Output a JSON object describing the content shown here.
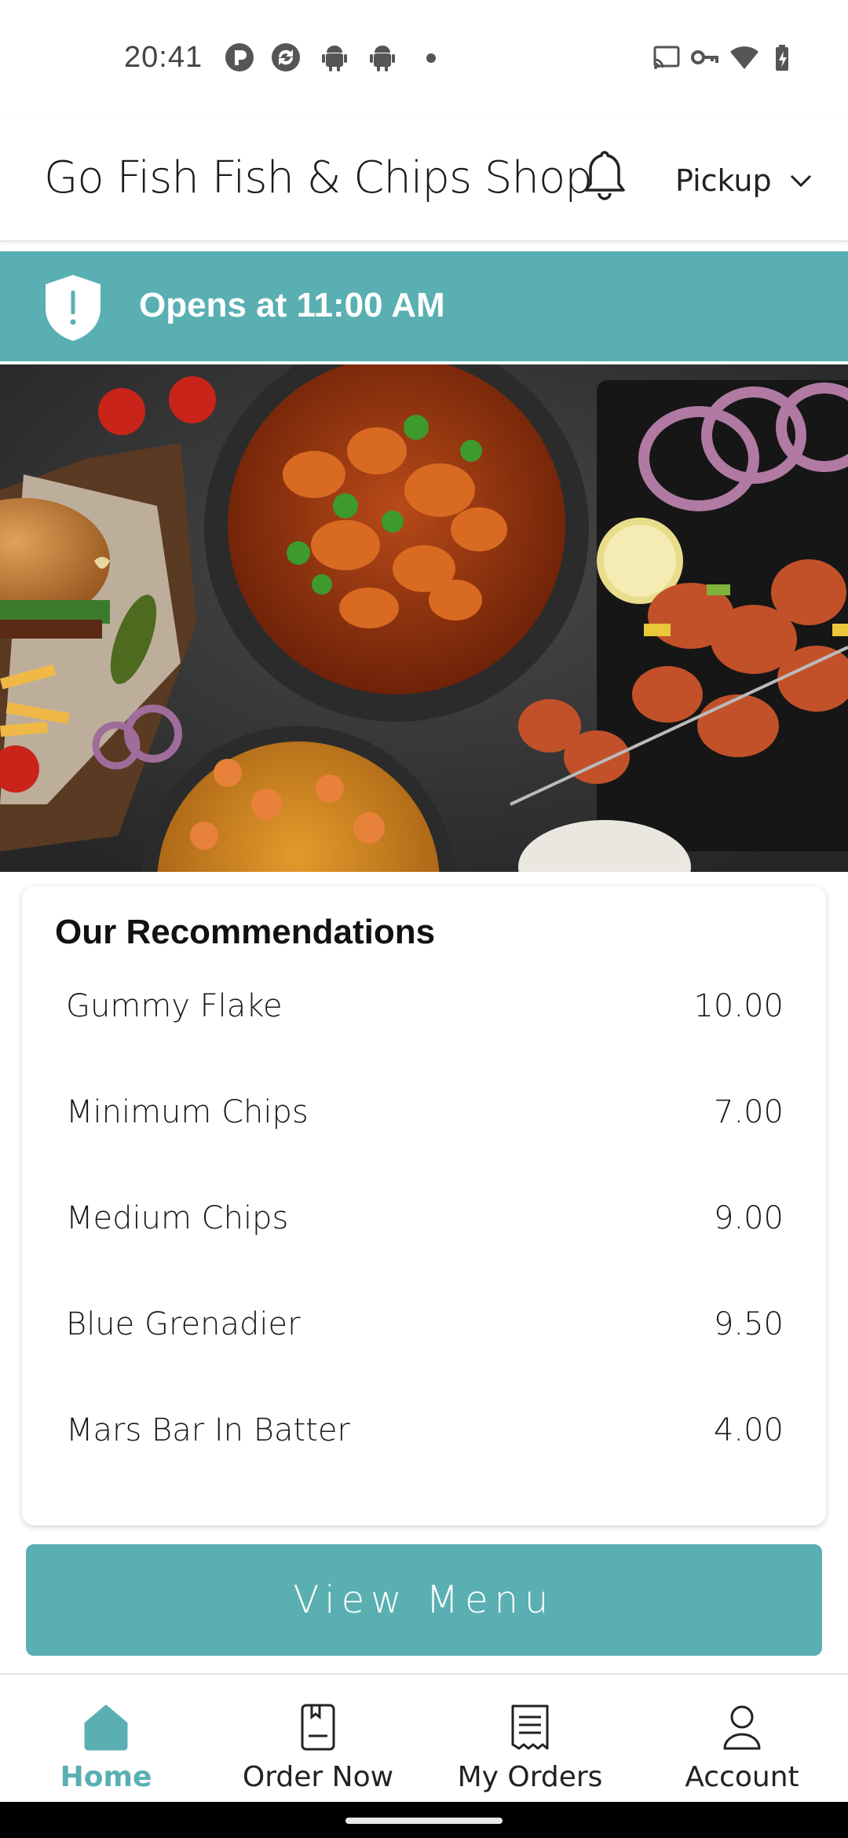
{
  "status_bar": {
    "time": "20:41",
    "left_icons": [
      "p-app-icon",
      "sync-app-icon",
      "android-icon",
      "android-icon",
      "notification-dot"
    ],
    "right_icons": [
      "cast-icon",
      "vpn-key-icon",
      "wifi-icon",
      "battery-charging-icon"
    ]
  },
  "header": {
    "title": "Go Fish Fish & Chips Shop",
    "notification_icon": "bell-icon",
    "order_type": "Pickup",
    "order_type_icon": "chevron-down-icon"
  },
  "banner": {
    "icon": "shield-alert-icon",
    "text": "Opens at 11:00 AM"
  },
  "hero": {
    "description_icon": "food-photo"
  },
  "recommendations": {
    "title": "Our Recommendations",
    "items": [
      {
        "name": "Gummy Flake",
        "price": "10.00"
      },
      {
        "name": "Minimum Chips",
        "price": "7.00"
      },
      {
        "name": "Medium Chips",
        "price": "9.00"
      },
      {
        "name": "Blue Grenadier",
        "price": "9.50"
      },
      {
        "name": "Mars Bar In Batter",
        "price": "4.00"
      }
    ]
  },
  "view_menu": {
    "label": "View Menu"
  },
  "bottom_nav": {
    "items": [
      {
        "label": "Home",
        "icon": "home-icon",
        "active": true
      },
      {
        "label": "Order Now",
        "icon": "order-book-icon",
        "active": false
      },
      {
        "label": "My Orders",
        "icon": "receipt-icon",
        "active": false
      },
      {
        "label": "Account",
        "icon": "user-icon",
        "active": false
      }
    ]
  },
  "colors": {
    "accent": "#5aafb2",
    "text": "#1a1a1a",
    "background": "#ffffff"
  }
}
